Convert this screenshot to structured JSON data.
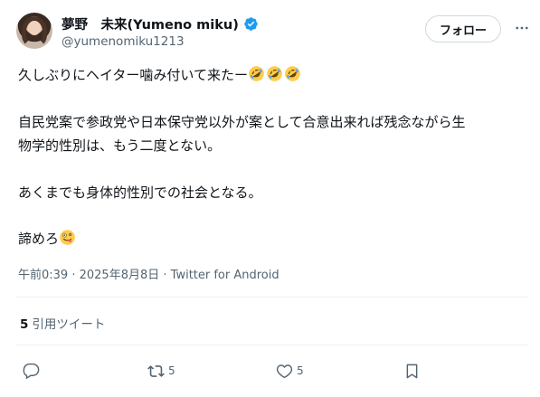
{
  "author": {
    "display_name": "夢野　未来(Yumeno miku)",
    "handle": "@yumenomiku1213",
    "verified": true
  },
  "follow_button": {
    "label": "フォロー"
  },
  "post": {
    "line1": "久しぶりにヘイター噛み付いて来たー",
    "para2_line1": "自民党案で参政党や日本保守党以外が案として合意出来れば残念ながら生",
    "para2_line2": "物学的性別は、もう二度とない。",
    "para3": "あくまでも身体的性別での社会となる。",
    "para4": "諦めろ",
    "emojis_line1": [
      "rolling-on-floor-laughing",
      "rolling-on-floor-laughing",
      "rolling-on-floor-laughing"
    ],
    "emoji_para4": "zany-face"
  },
  "meta": {
    "time": "午前0:39",
    "sep1": " · ",
    "date": "2025年8月8日",
    "sep2": " · ",
    "source": "Twitter for Android"
  },
  "quotes": {
    "count": "5",
    "label": "引用ツイート"
  },
  "actions": {
    "reply_count": "",
    "retweet_count": "5",
    "like_count": "5"
  },
  "colors": {
    "verified": "#1d9bf0",
    "text": "#0f1419",
    "secondary": "#536471",
    "border": "#eff3f4"
  }
}
